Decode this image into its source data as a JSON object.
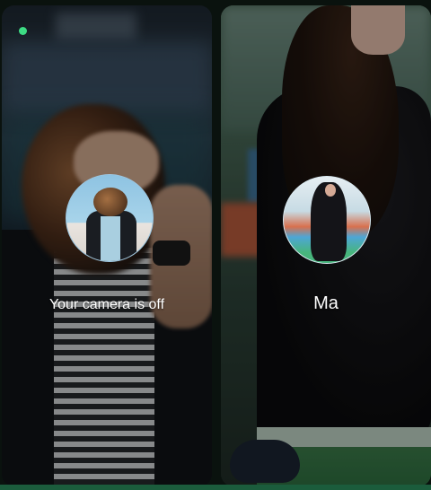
{
  "call": {
    "self_tile": {
      "status_text": "Your camera is off",
      "indicator_color": "#3ddc84"
    },
    "remote_tile": {
      "name": "Ma"
    }
  },
  "colors": {
    "label_text": "#ffffff",
    "bottom_accent": "#1b5c3c"
  }
}
